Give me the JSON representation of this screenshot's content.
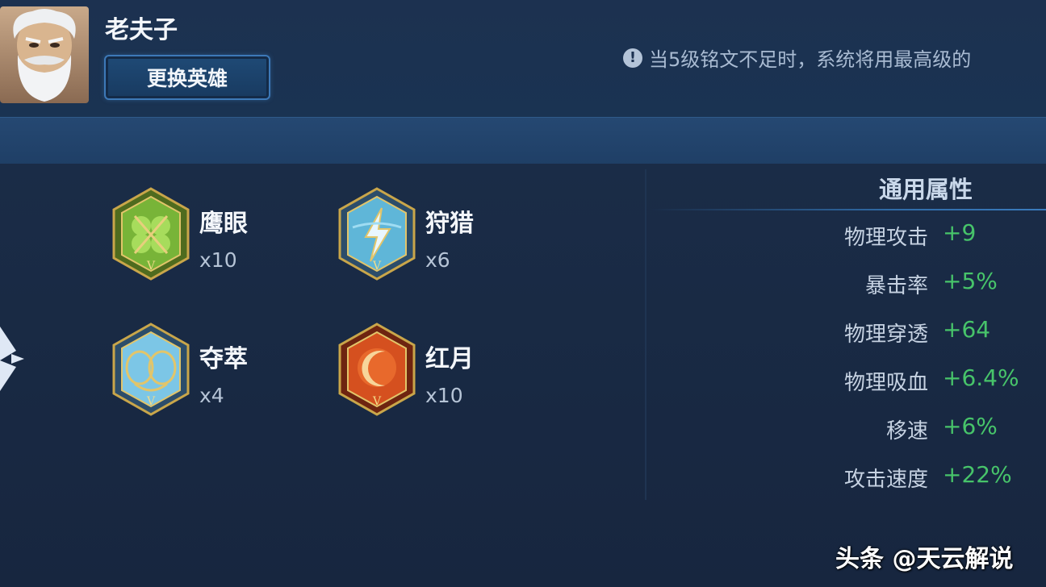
{
  "hero": {
    "name": "老夫子",
    "swap_label": "更换英雄"
  },
  "notice": {
    "icon": "exclamation-icon",
    "text": "当5级铭文不足时，系统将用最高级的"
  },
  "runes": [
    {
      "name": "鹰眼",
      "count": "x10",
      "icon": "rune-green-hexagon-icon",
      "grade": "V"
    },
    {
      "name": "狩猎",
      "count": "x6",
      "icon": "rune-blue-lightning-hexagon-icon",
      "grade": "V"
    },
    {
      "name": "夺萃",
      "count": "x4",
      "icon": "rune-blue-knot-hexagon-icon",
      "grade": "V"
    },
    {
      "name": "红月",
      "count": "x10",
      "icon": "rune-red-moon-hexagon-icon",
      "grade": "V"
    }
  ],
  "attributes": {
    "title": "通用属性",
    "items": [
      {
        "label": "物理攻击",
        "value": "+9"
      },
      {
        "label": "暴击率",
        "value": "+5%"
      },
      {
        "label": "物理穿透",
        "value": "+64"
      },
      {
        "label": "物理吸血",
        "value": "+6.4%"
      },
      {
        "label": "移速",
        "value": "+6%"
      },
      {
        "label": "攻击速度",
        "value": "+22%"
      }
    ]
  },
  "watermark": "头条 @天云解说",
  "colors": {
    "background": "#1b2c48",
    "value_green": "#47c46a",
    "button_border": "#3d79b8"
  }
}
